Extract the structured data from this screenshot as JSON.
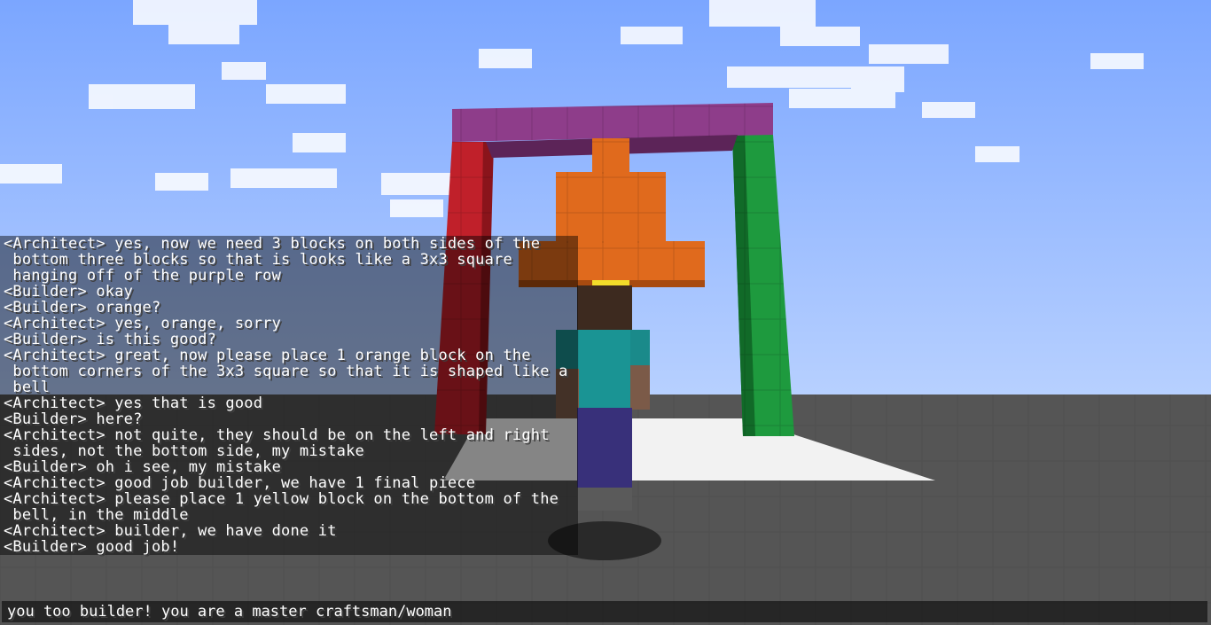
{
  "chat": {
    "lines": [
      "<Architect> yes, now we need 3 blocks on both sides of the",
      " bottom three blocks so that is looks like a 3x3 square",
      " hanging off of the purple row",
      "<Builder> okay",
      "<Builder> orange?",
      "<Architect> yes, orange, sorry",
      "<Builder> is this good?",
      "<Architect> great, now please place 1 orange block on the",
      " bottom corners of the 3x3 square so that it is shaped like a",
      " bell",
      "<Architect> yes that is good",
      "<Builder> here?",
      "<Architect> not quite, they should be on the left and right",
      " sides, not the bottom side, my mistake",
      "<Builder> oh i see, my mistake",
      "<Architect> good job builder, we have 1 final piece",
      "<Architect> please place 1 yellow block on the bottom of the",
      " bell, in the middle",
      "<Architect> builder, we have done it",
      "<Builder> good job!"
    ]
  },
  "input": {
    "value": "you too builder! you are a master craftsman/woman"
  },
  "colors": {
    "sky": "#7aa5ff",
    "ground": "#555555",
    "purple": "#8e3d8a",
    "red": "#c0202a",
    "green": "#1e9a3e",
    "orange": "#e06a1d",
    "yellow": "#f2dc2a",
    "player_shirt": "#1a9494",
    "player_pants": "#38307a"
  }
}
